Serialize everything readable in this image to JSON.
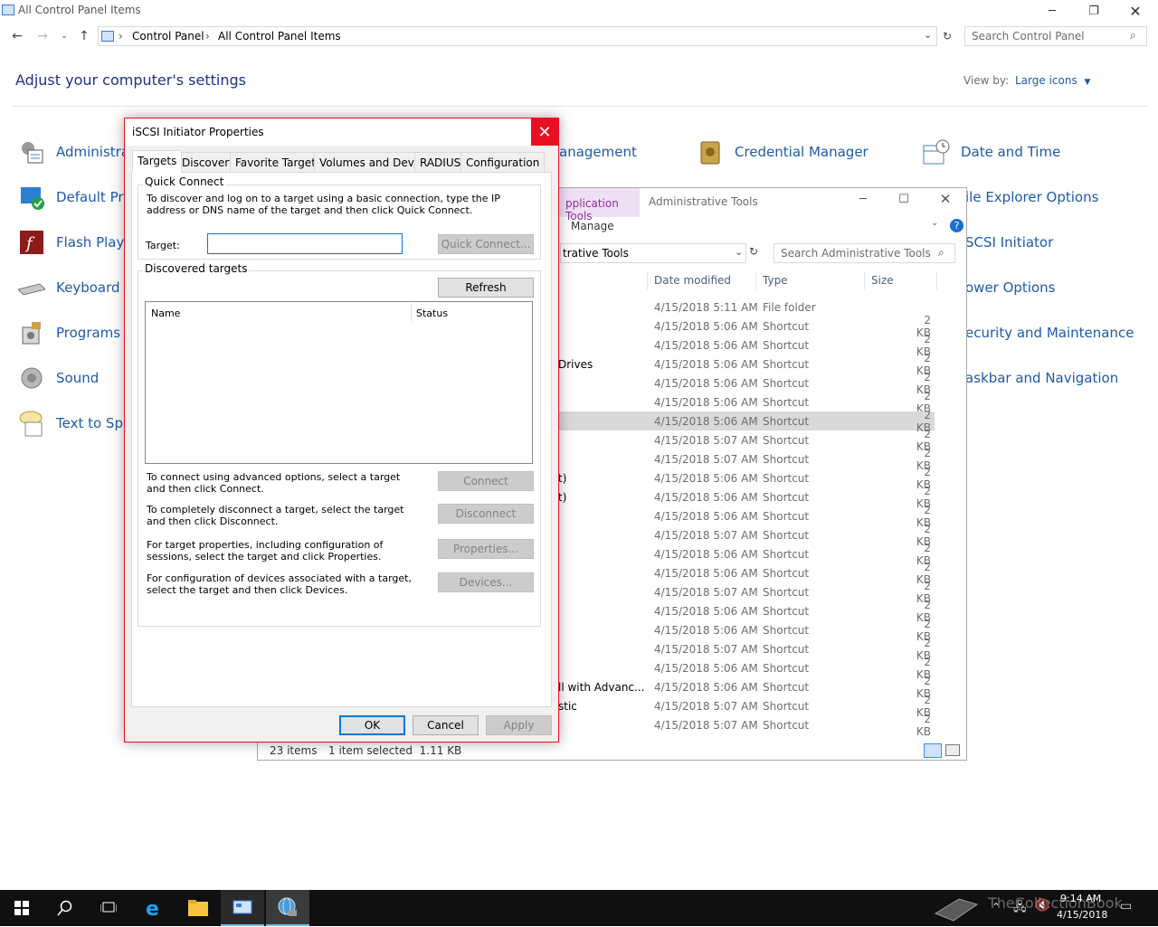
{
  "control_panel": {
    "window_title": "All Control Panel Items",
    "breadcrumb": [
      "Control Panel",
      "All Control Panel Items"
    ],
    "search_placeholder": "Search Control Panel",
    "heading": "Adjust your computer's settings",
    "view_by_label": "View by:",
    "view_by_value": "Large icons",
    "items_col1": [
      {
        "label": "Administra",
        "icon": "administrative-tools-icon"
      },
      {
        "label": "Default Pro",
        "icon": "default-programs-icon"
      },
      {
        "label": "Flash Playe",
        "icon": "flash-player-icon"
      },
      {
        "label": "Keyboard",
        "icon": "keyboard-icon"
      },
      {
        "label": "Programs a",
        "icon": "programs-icon"
      },
      {
        "label": "Sound",
        "icon": "sound-icon"
      },
      {
        "label": "Text to Spe",
        "icon": "speech-icon"
      }
    ],
    "items_col2": [
      {
        "label": "anagement",
        "icon": ""
      }
    ],
    "items_col3": [
      {
        "label": "Credential Manager",
        "icon": "credential-manager-icon"
      }
    ],
    "items_col4": [
      {
        "label": "Date and Time",
        "icon": "date-time-icon"
      },
      {
        "label": "ile Explorer Options",
        "icon": ""
      },
      {
        "label": "SCSI Initiator",
        "icon": ""
      },
      {
        "label": "ower Options",
        "icon": ""
      },
      {
        "label": "ecurity and Maintenance",
        "icon": ""
      },
      {
        "label": "askbar and Navigation",
        "icon": ""
      }
    ]
  },
  "admin_tools": {
    "ribbon_context": "pplication Tools",
    "ribbon_manage": "Manage",
    "title": "Administrative Tools",
    "address": "trative Tools",
    "search_placeholder": "Search Administrative Tools",
    "columns": {
      "date": "Date modified",
      "type": "Type",
      "size": "Size"
    },
    "rows": [
      {
        "name": "",
        "date": "4/15/2018 5:11 AM",
        "type": "File folder",
        "size": ""
      },
      {
        "name": "",
        "date": "4/15/2018 5:06 AM",
        "type": "Shortcut",
        "size": "2 KB"
      },
      {
        "name": "",
        "date": "4/15/2018 5:06 AM",
        "type": "Shortcut",
        "size": "2 KB"
      },
      {
        "name": "Drives",
        "date": "4/15/2018 5:06 AM",
        "type": "Shortcut",
        "size": "2 KB"
      },
      {
        "name": "",
        "date": "4/15/2018 5:06 AM",
        "type": "Shortcut",
        "size": "2 KB"
      },
      {
        "name": "",
        "date": "4/15/2018 5:06 AM",
        "type": "Shortcut",
        "size": "2 KB"
      },
      {
        "name": "",
        "date": "4/15/2018 5:06 AM",
        "type": "Shortcut",
        "size": "2 KB",
        "selected": true
      },
      {
        "name": "",
        "date": "4/15/2018 5:07 AM",
        "type": "Shortcut",
        "size": "2 KB"
      },
      {
        "name": "",
        "date": "4/15/2018 5:07 AM",
        "type": "Shortcut",
        "size": "2 KB"
      },
      {
        "name": "t)",
        "date": "4/15/2018 5:06 AM",
        "type": "Shortcut",
        "size": "2 KB"
      },
      {
        "name": "t)",
        "date": "4/15/2018 5:06 AM",
        "type": "Shortcut",
        "size": "2 KB"
      },
      {
        "name": "",
        "date": "4/15/2018 5:06 AM",
        "type": "Shortcut",
        "size": "2 KB"
      },
      {
        "name": "",
        "date": "4/15/2018 5:07 AM",
        "type": "Shortcut",
        "size": "2 KB"
      },
      {
        "name": "",
        "date": "4/15/2018 5:06 AM",
        "type": "Shortcut",
        "size": "2 KB"
      },
      {
        "name": "",
        "date": "4/15/2018 5:06 AM",
        "type": "Shortcut",
        "size": "2 KB"
      },
      {
        "name": "",
        "date": "4/15/2018 5:07 AM",
        "type": "Shortcut",
        "size": "2 KB"
      },
      {
        "name": "",
        "date": "4/15/2018 5:06 AM",
        "type": "Shortcut",
        "size": "2 KB"
      },
      {
        "name": "",
        "date": "4/15/2018 5:06 AM",
        "type": "Shortcut",
        "size": "2 KB"
      },
      {
        "name": "",
        "date": "4/15/2018 5:07 AM",
        "type": "Shortcut",
        "size": "2 KB"
      },
      {
        "name": "",
        "date": "4/15/2018 5:06 AM",
        "type": "Shortcut",
        "size": "2 KB"
      },
      {
        "name": "ll with Advanc...",
        "date": "4/15/2018 5:06 AM",
        "type": "Shortcut",
        "size": "2 KB"
      },
      {
        "name": "stic",
        "date": "4/15/2018 5:07 AM",
        "type": "Shortcut",
        "size": "2 KB"
      },
      {
        "name": "",
        "date": "4/15/2018 5:07 AM",
        "type": "Shortcut",
        "size": "2 KB"
      }
    ],
    "status_items": "23 items",
    "status_selected": "1 item selected  1.11 KB"
  },
  "dialog": {
    "title": "iSCSI Initiator Properties",
    "tabs": [
      "Targets",
      "Discovery",
      "Favorite Targets",
      "Volumes and Devices",
      "RADIUS",
      "Configuration"
    ],
    "quick_connect": {
      "group_label": "Quick Connect",
      "description": "To discover and log on to a target using a basic connection, type the IP address or DNS name of the target and then click Quick Connect.",
      "target_label": "Target:",
      "target_value": "",
      "button": "Quick Connect..."
    },
    "discovered": {
      "group_label": "Discovered targets",
      "refresh": "Refresh",
      "col_name": "Name",
      "col_status": "Status"
    },
    "actions": [
      {
        "text": "To connect using advanced options, select a target and then click Connect.",
        "button": "Connect"
      },
      {
        "text": "To completely disconnect a target, select the target and then click Disconnect.",
        "button": "Disconnect"
      },
      {
        "text": "For target properties, including configuration of sessions, select the target and click Properties.",
        "button": "Properties..."
      },
      {
        "text": "For configuration of devices associated with a target, select the target and then click Devices.",
        "button": "Devices..."
      }
    ],
    "ok": "OK",
    "cancel": "Cancel",
    "apply": "Apply"
  },
  "taskbar": {
    "time": "9:14 AM",
    "date": "4/15/2018",
    "watermark": "TheCollectionBook"
  }
}
